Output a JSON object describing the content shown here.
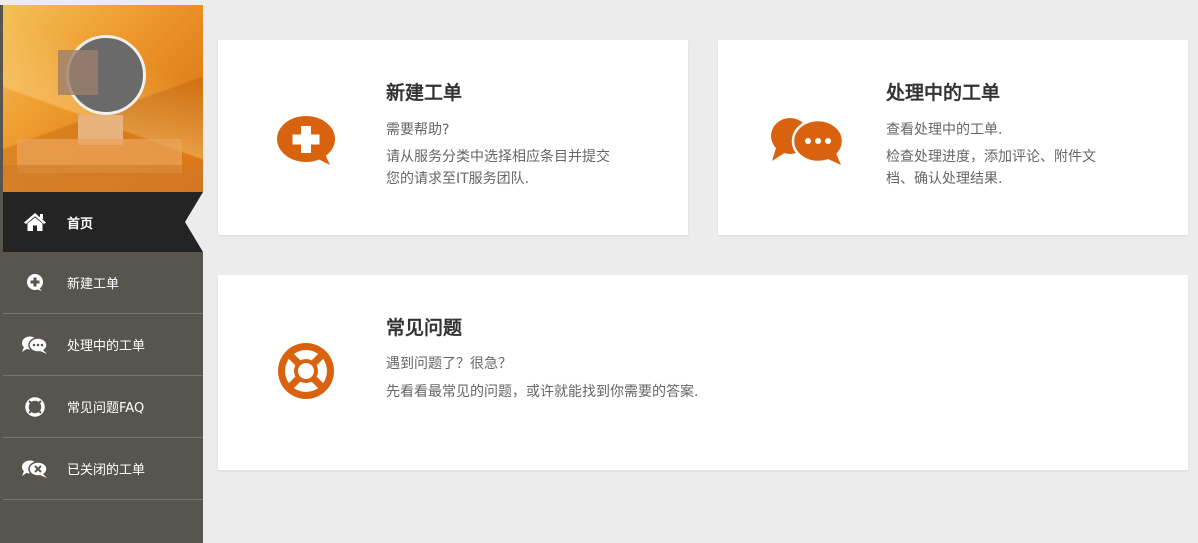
{
  "nav": {
    "home": "首页",
    "new_ticket": "新建工单",
    "processing": "处理中的工单",
    "faq": "常见问题FAQ",
    "closed": "已关闭的工单"
  },
  "cards": {
    "new_ticket": {
      "title": "新建工单",
      "line1": "需要帮助?",
      "line2": "请从服务分类中选择相应条目并提交",
      "line3": "您的请求至IT服务团队."
    },
    "processing": {
      "title": "处理中的工单",
      "line1": "查看处理中的工单.",
      "line2": "检查处理进度，添加评论、附件文",
      "line3": "档、确认处理结果."
    },
    "faq": {
      "title": "常见问题",
      "line1": "遇到问题了？很急？",
      "line2": "先看看最常见的问题，或许就能找到你需要的答案."
    }
  },
  "colors": {
    "accent": "#d9620f",
    "sidebar": "#58554f",
    "sidebar_active": "#252424",
    "background": "#ececec"
  },
  "icons": {
    "home": "home-icon",
    "new_ticket": "chat-plus-icon",
    "processing": "chat-bubbles-icon",
    "faq": "lifebuoy-icon",
    "closed": "chat-closed-icon"
  }
}
